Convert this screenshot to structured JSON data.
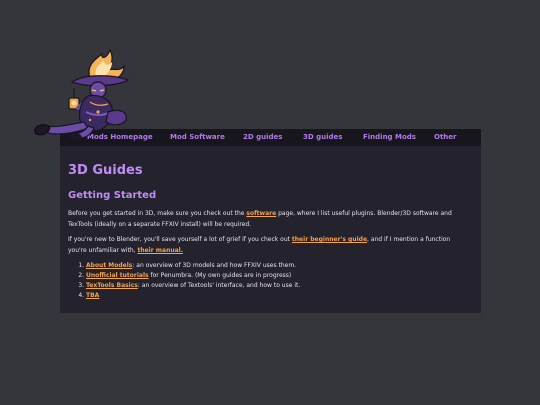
{
  "colors": {
    "page_background": "#35353c",
    "nav_background": "#17161d",
    "panel_background": "#24222c",
    "accent_purple": "#b07bea",
    "link_orange": "#f2a54d",
    "text_light": "#e7e4ee"
  },
  "nav": {
    "items": [
      {
        "label": "Mods Homepage"
      },
      {
        "label": "Mod Software"
      },
      {
        "label": "2D guides"
      },
      {
        "label": "3D guides"
      },
      {
        "label": "Finding Mods"
      },
      {
        "label": "Other"
      }
    ]
  },
  "main": {
    "title": "3D Guides",
    "section_title": "Getting Started",
    "para1": {
      "before": "Before you get started in 3D, make sure you check out the ",
      "link": "software",
      "after": " page, where I list useful plugins. Blender/3D software and TexTools (ideally on a separate FFXIV install) will be required."
    },
    "para2": {
      "before": "If you're new to Blender, you'll save yourself a lot of grief if you check out ",
      "link1": "their beginner's guide",
      "middle": ", and if I mention a function you're unfamiliar with, ",
      "link2": "their manual."
    },
    "guides": [
      {
        "link": "About Models",
        "text": ": an overview of 3D models and how FFXIV uses them."
      },
      {
        "link": "Unofficial tutorials",
        "text": " for Penumbra. (My own guides are in progress)"
      },
      {
        "link": "TexTools Basics",
        "text": ": an overview of Textools' interface, and how to use it."
      },
      {
        "link": "TBA",
        "text": ""
      }
    ]
  }
}
